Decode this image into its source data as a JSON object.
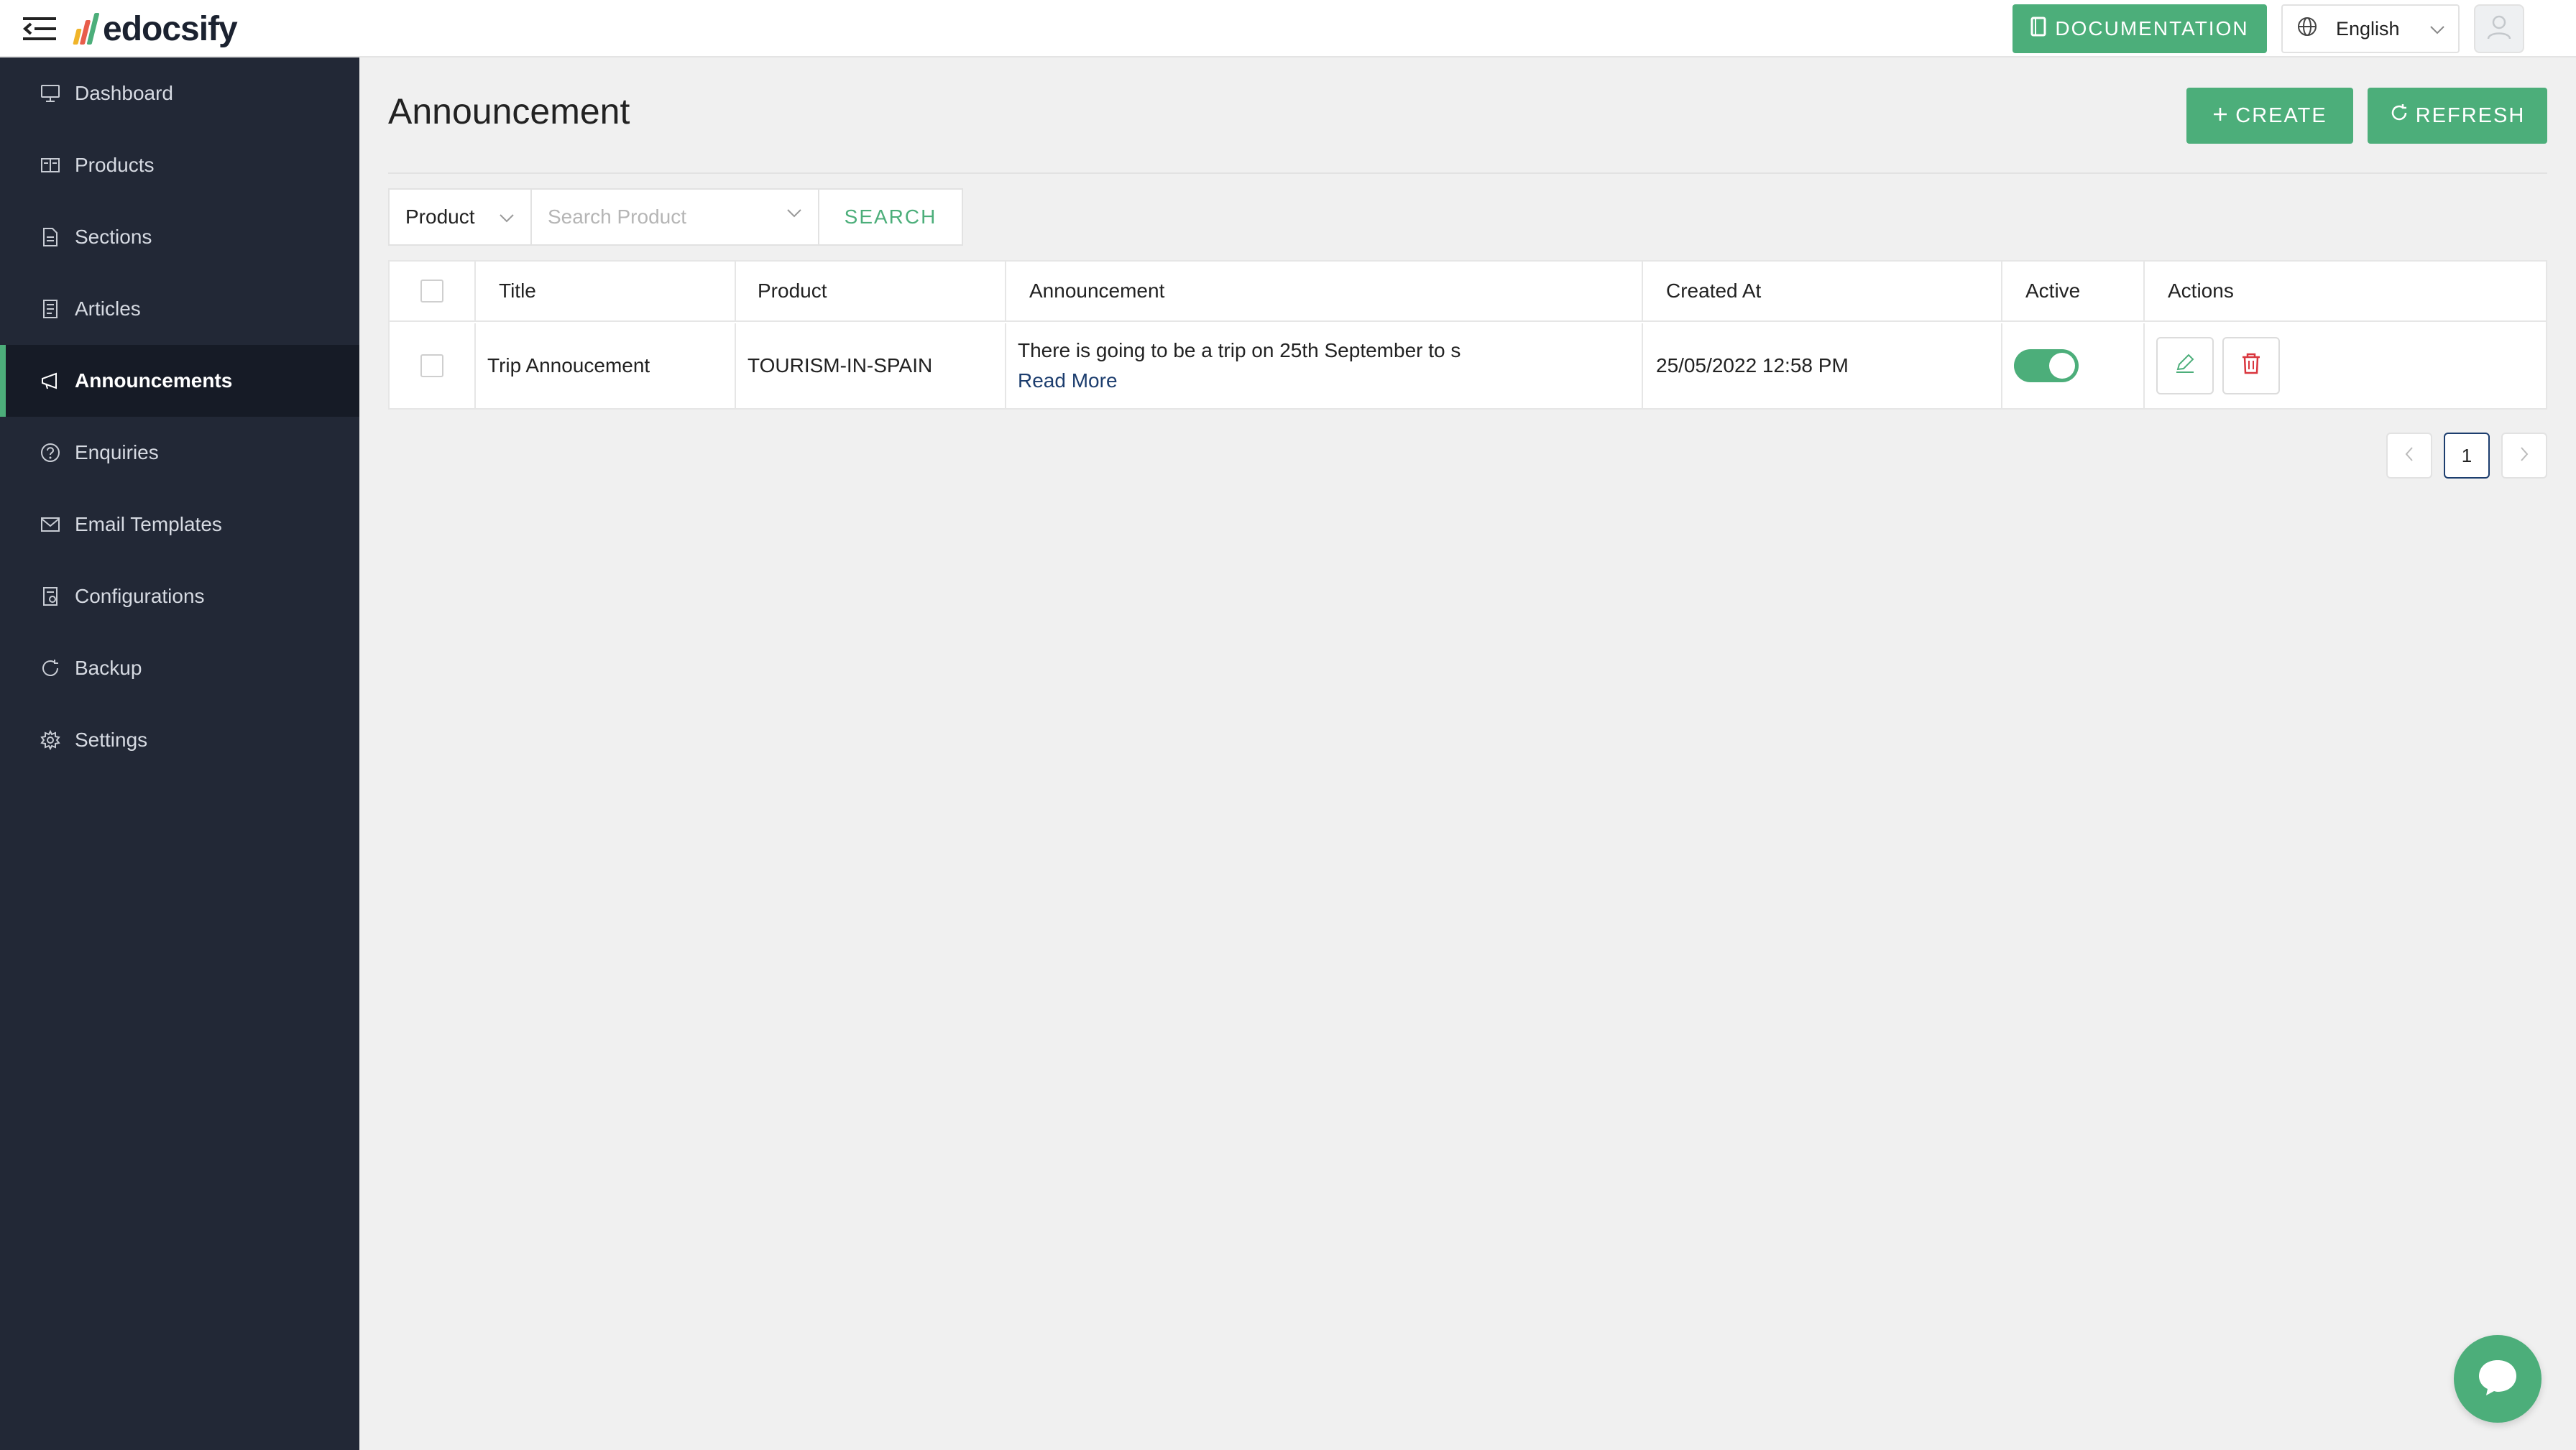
{
  "app": {
    "logo_text": "edocsify",
    "brand_color": "#4cae7a",
    "icons": {
      "menu": "menu-collapse-icon",
      "documentation": "book-icon",
      "language": "globe-icon",
      "avatar": "user-icon",
      "chat": "chat-bubble-icon"
    }
  },
  "topbar": {
    "documentation_label": "DOCUMENTATION",
    "language_value": "English"
  },
  "sidebar": {
    "items": [
      {
        "label": "Dashboard",
        "icon": "monitor-icon"
      },
      {
        "label": "Products",
        "icon": "product-icon"
      },
      {
        "label": "Sections",
        "icon": "file-icon"
      },
      {
        "label": "Articles",
        "icon": "article-icon"
      },
      {
        "label": "Announcements",
        "icon": "megaphone-icon",
        "active": true
      },
      {
        "label": "Enquiries",
        "icon": "question-icon"
      },
      {
        "label": "Email Templates",
        "icon": "mail-icon"
      },
      {
        "label": "Configurations",
        "icon": "config-icon"
      },
      {
        "label": "Backup",
        "icon": "sync-icon"
      },
      {
        "label": "Settings",
        "icon": "gear-icon"
      }
    ]
  },
  "main": {
    "title": "Announcement",
    "create_label": "CREATE",
    "refresh_label": "REFRESH",
    "search": {
      "field_value": "Product",
      "placeholder": "Search Product",
      "button_label": "SEARCH"
    },
    "table": {
      "columns": [
        "Title",
        "Product",
        "Announcement",
        "Created At",
        "Active",
        "Actions"
      ],
      "rows": [
        {
          "title": "Trip Annoucement",
          "product": "TOURISM-IN-SPAIN",
          "announcement": "There is going to be a trip on 25th September to s",
          "read_more": "Read More",
          "created_at": "25/05/2022 12:58 PM",
          "active": true
        }
      ]
    },
    "pagination": {
      "current_page": "1",
      "prev": "<",
      "next": ">"
    }
  }
}
